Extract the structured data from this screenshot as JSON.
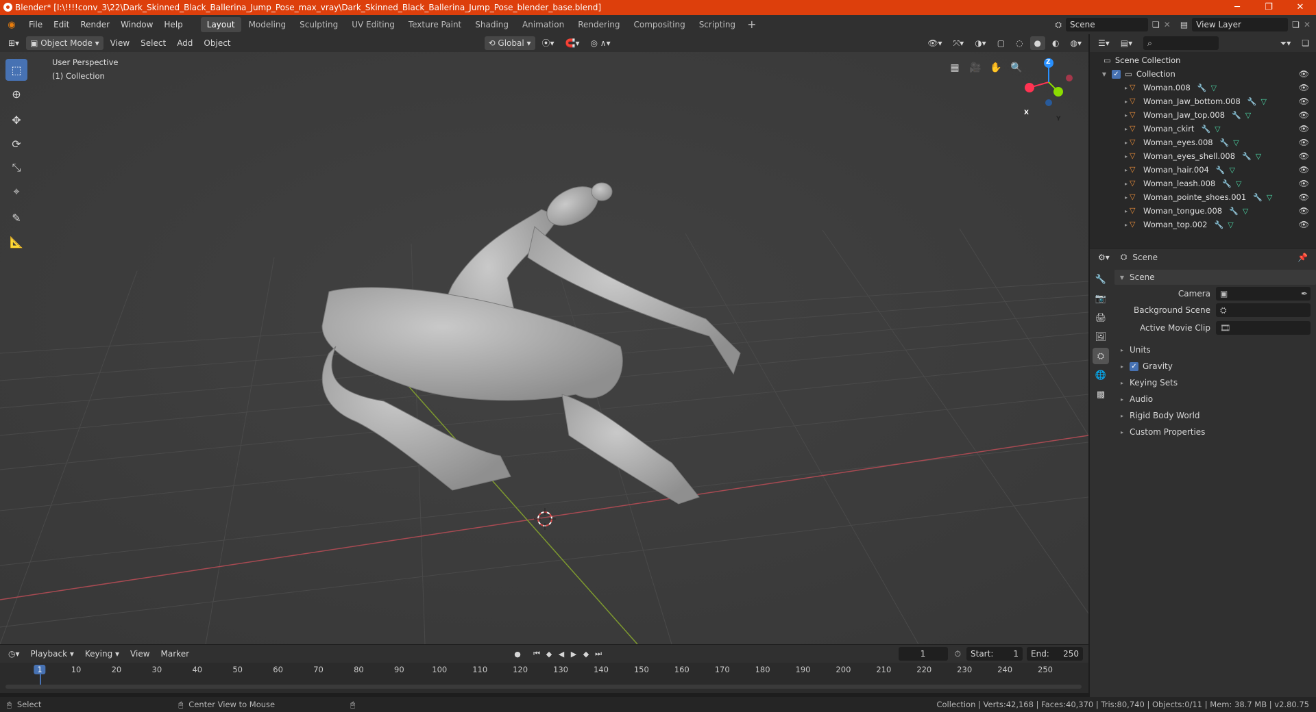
{
  "window": {
    "title": "Blender* [I:\\!!!!conv_3\\22\\Dark_Skinned_Black_Ballerina_Jump_Pose_max_vray\\Dark_Skinned_Black_Ballerina_Jump_Pose_blender_base.blend]",
    "minimize": "─",
    "maximize": "❐",
    "close": "✕"
  },
  "menus": [
    "File",
    "Edit",
    "Render",
    "Window",
    "Help"
  ],
  "workspaces": [
    "Layout",
    "Modeling",
    "Sculpting",
    "UV Editing",
    "Texture Paint",
    "Shading",
    "Animation",
    "Rendering",
    "Compositing",
    "Scripting"
  ],
  "workspace_add": "+",
  "scene": {
    "label": "Scene",
    "view_layer": "View Layer"
  },
  "viewport_header": {
    "mode": "Object Mode",
    "view": "View",
    "select": "Select",
    "add": "Add",
    "object": "Object",
    "orientation": "Global"
  },
  "viewport": {
    "perspective": "User Perspective",
    "collection": "(1) Collection",
    "axis_x": "X",
    "axis_y": "Y",
    "axis_z": "Z"
  },
  "outliner": {
    "root": "Scene Collection",
    "collection": "Collection",
    "items": [
      "Woman.008",
      "Woman_Jaw_bottom.008",
      "Woman_Jaw_top.008",
      "Woman_ckirt",
      "Woman_eyes.008",
      "Woman_eyes_shell.008",
      "Woman_hair.004",
      "Woman_leash.008",
      "Woman_pointe_shoes.001",
      "Woman_tongue.008",
      "Woman_top.002"
    ]
  },
  "properties": {
    "header": "Scene",
    "panel": "Scene",
    "camera": "Camera",
    "background_scene": "Background Scene",
    "active_movie_clip": "Active Movie Clip",
    "sections": [
      "Units",
      "Gravity",
      "Keying Sets",
      "Audio",
      "Rigid Body World",
      "Custom Properties"
    ]
  },
  "timeline": {
    "playback": "Playback",
    "keying": "Keying",
    "view": "View",
    "marker": "Marker",
    "current_frame": "1",
    "start_label": "Start:",
    "start": "1",
    "end_label": "End:",
    "end": "250",
    "ticks": [
      "1",
      "10",
      "20",
      "30",
      "40",
      "50",
      "60",
      "70",
      "80",
      "90",
      "100",
      "110",
      "120",
      "130",
      "140",
      "150",
      "160",
      "170",
      "180",
      "190",
      "200",
      "210",
      "220",
      "230",
      "240",
      "250"
    ]
  },
  "status": {
    "select": "Select",
    "center": "Center View to Mouse",
    "stats": "Collection | Verts:42,168 | Faces:40,370 | Tris:80,740 | Objects:0/11 | Mem: 38.7 MB | v2.80.75"
  },
  "colors": {
    "accent": "#4772b3",
    "titlebar": "#dd3f0c",
    "x_axis": "#ff3352",
    "y_axis": "#8bdc00",
    "z_axis": "#2890ff"
  }
}
